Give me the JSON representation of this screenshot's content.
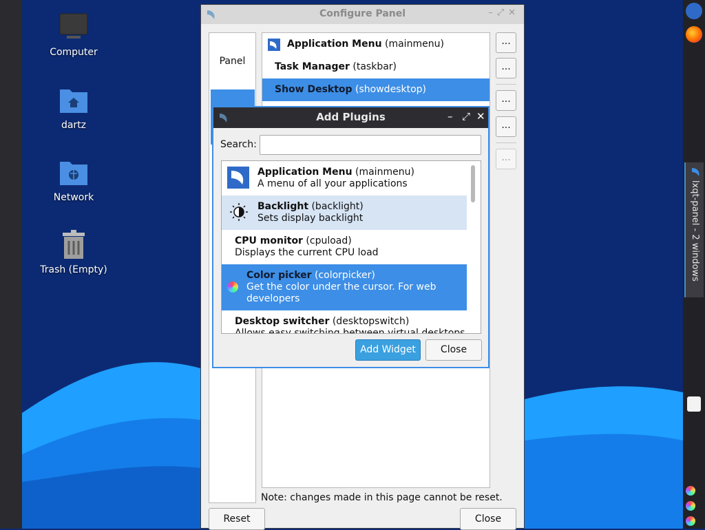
{
  "desktop": {
    "icons": [
      {
        "label": "Computer",
        "icon": "computer-icon"
      },
      {
        "label": "dartz",
        "icon": "home-folder-icon"
      },
      {
        "label": "Network",
        "icon": "network-folder-icon"
      },
      {
        "label": "Trash (Empty)",
        "icon": "trash-icon"
      }
    ]
  },
  "panel": {
    "task_label": "lxqt-panel - 2 windows"
  },
  "configure_panel": {
    "title": "Configure Panel",
    "side": {
      "panel_label": "Panel"
    },
    "widgets": [
      {
        "name": "Application Menu",
        "id": "(mainmenu)"
      },
      {
        "name": "Task Manager",
        "id": "(taskbar)"
      },
      {
        "name": "Show Desktop",
        "id": "(showdesktop)"
      }
    ],
    "dots_label": "...",
    "note": "Note: changes made in this page cannot be reset.",
    "reset_label": "Reset",
    "close_label": "Close"
  },
  "add_plugins": {
    "title": "Add Plugins",
    "search_label": "Search:",
    "search_value": "",
    "plugins": [
      {
        "name": "Application Menu",
        "id": "(mainmenu)",
        "desc": "A menu of all your applications"
      },
      {
        "name": "Backlight",
        "id": "(backlight)",
        "desc": "Sets display backlight"
      },
      {
        "name": "CPU monitor",
        "id": "(cpuload)",
        "desc": "Displays the current CPU load"
      },
      {
        "name": "Color picker",
        "id": "(colorpicker)",
        "desc": "Get the color under the cursor. For web",
        "desc2": "developers"
      },
      {
        "name": "Desktop switcher",
        "id": "(desktopswitch)",
        "desc": "Allows easy switching between virtual desktops"
      }
    ],
    "add_label": "Add Widget",
    "close_label": "Close"
  },
  "colors": {
    "accent": "#3d8ee6",
    "button_accent": "#3aa0e0",
    "wallpaper_dark": "#0c2a73",
    "wave_light": "#1f9fff"
  }
}
